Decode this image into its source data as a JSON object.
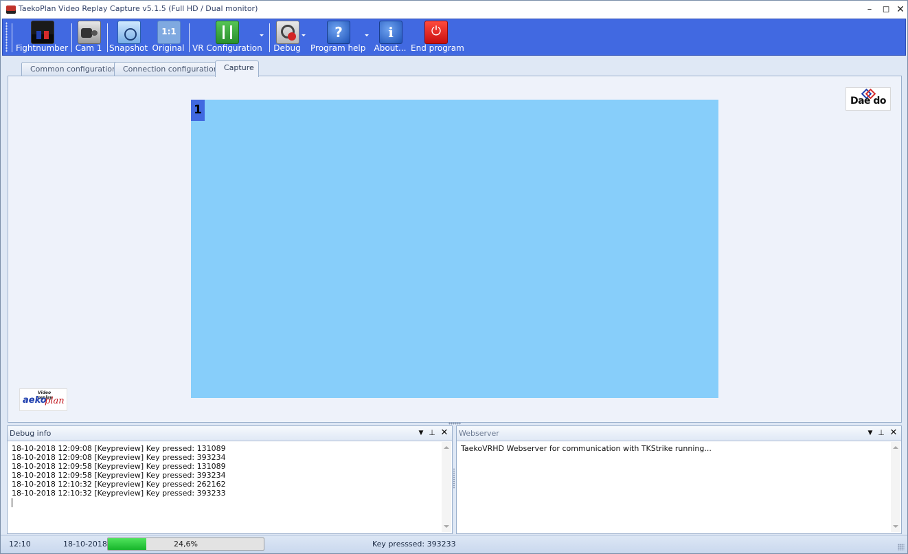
{
  "window": {
    "title": "TaekoPlan Video Replay Capture v5.1.5 (Full HD / Dual monitor)",
    "controls": {
      "minimize": "–",
      "maximize": "◻",
      "close": "✕"
    }
  },
  "toolbar": {
    "fightnumber": "Fightnumber",
    "cam": "Cam 1",
    "snapshot": "Snapshot",
    "original": "Original",
    "original_icon_text": "1:1",
    "vr_configuration": "VR Configuration",
    "debug": "Debug",
    "program_help": "Program help",
    "about": "About...",
    "end_program": "End program",
    "help_icon_text": "?",
    "about_icon_text": "i",
    "end_icon_text": "⏻"
  },
  "tabs": [
    {
      "label": "Common configuration",
      "active": false
    },
    {
      "label": "Connection configuration",
      "active": false
    },
    {
      "label": "Capture",
      "active": true
    }
  ],
  "capture": {
    "camera_number": "1",
    "video_color": "#87cefa",
    "daedo_logo": "Dae do",
    "taeko_logo": {
      "tagline": "Video replay",
      "word1": "aeko",
      "word2": "plan"
    }
  },
  "debug_panel": {
    "title": "Debug info",
    "lines": [
      "18-10-2018 12:09:08 [Keypreview] Key pressed: 131089",
      "18-10-2018 12:09:08 [Keypreview] Key pressed: 393234",
      "18-10-2018 12:09:58 [Keypreview] Key pressed: 131089",
      "18-10-2018 12:09:58 [Keypreview] Key pressed: 393234",
      "18-10-2018 12:10:32 [Keypreview] Key pressed: 262162",
      "18-10-2018 12:10:32 [Keypreview] Key pressed: 393233"
    ]
  },
  "web_panel": {
    "title": "Webserver",
    "lines": [
      "TaekoVRHD Webserver for communication with TKStrike running..."
    ]
  },
  "status": {
    "time": "12:10",
    "date": "18-10-2018",
    "progress_text": "24,6%",
    "progress_fraction": 0.246,
    "last_key": "Key presssed: 393233"
  },
  "colors": {
    "toolbar": "#4169e1",
    "video": "#87cefa",
    "camera_badge": "#4169e1",
    "progress_fill": "#17b52b"
  }
}
